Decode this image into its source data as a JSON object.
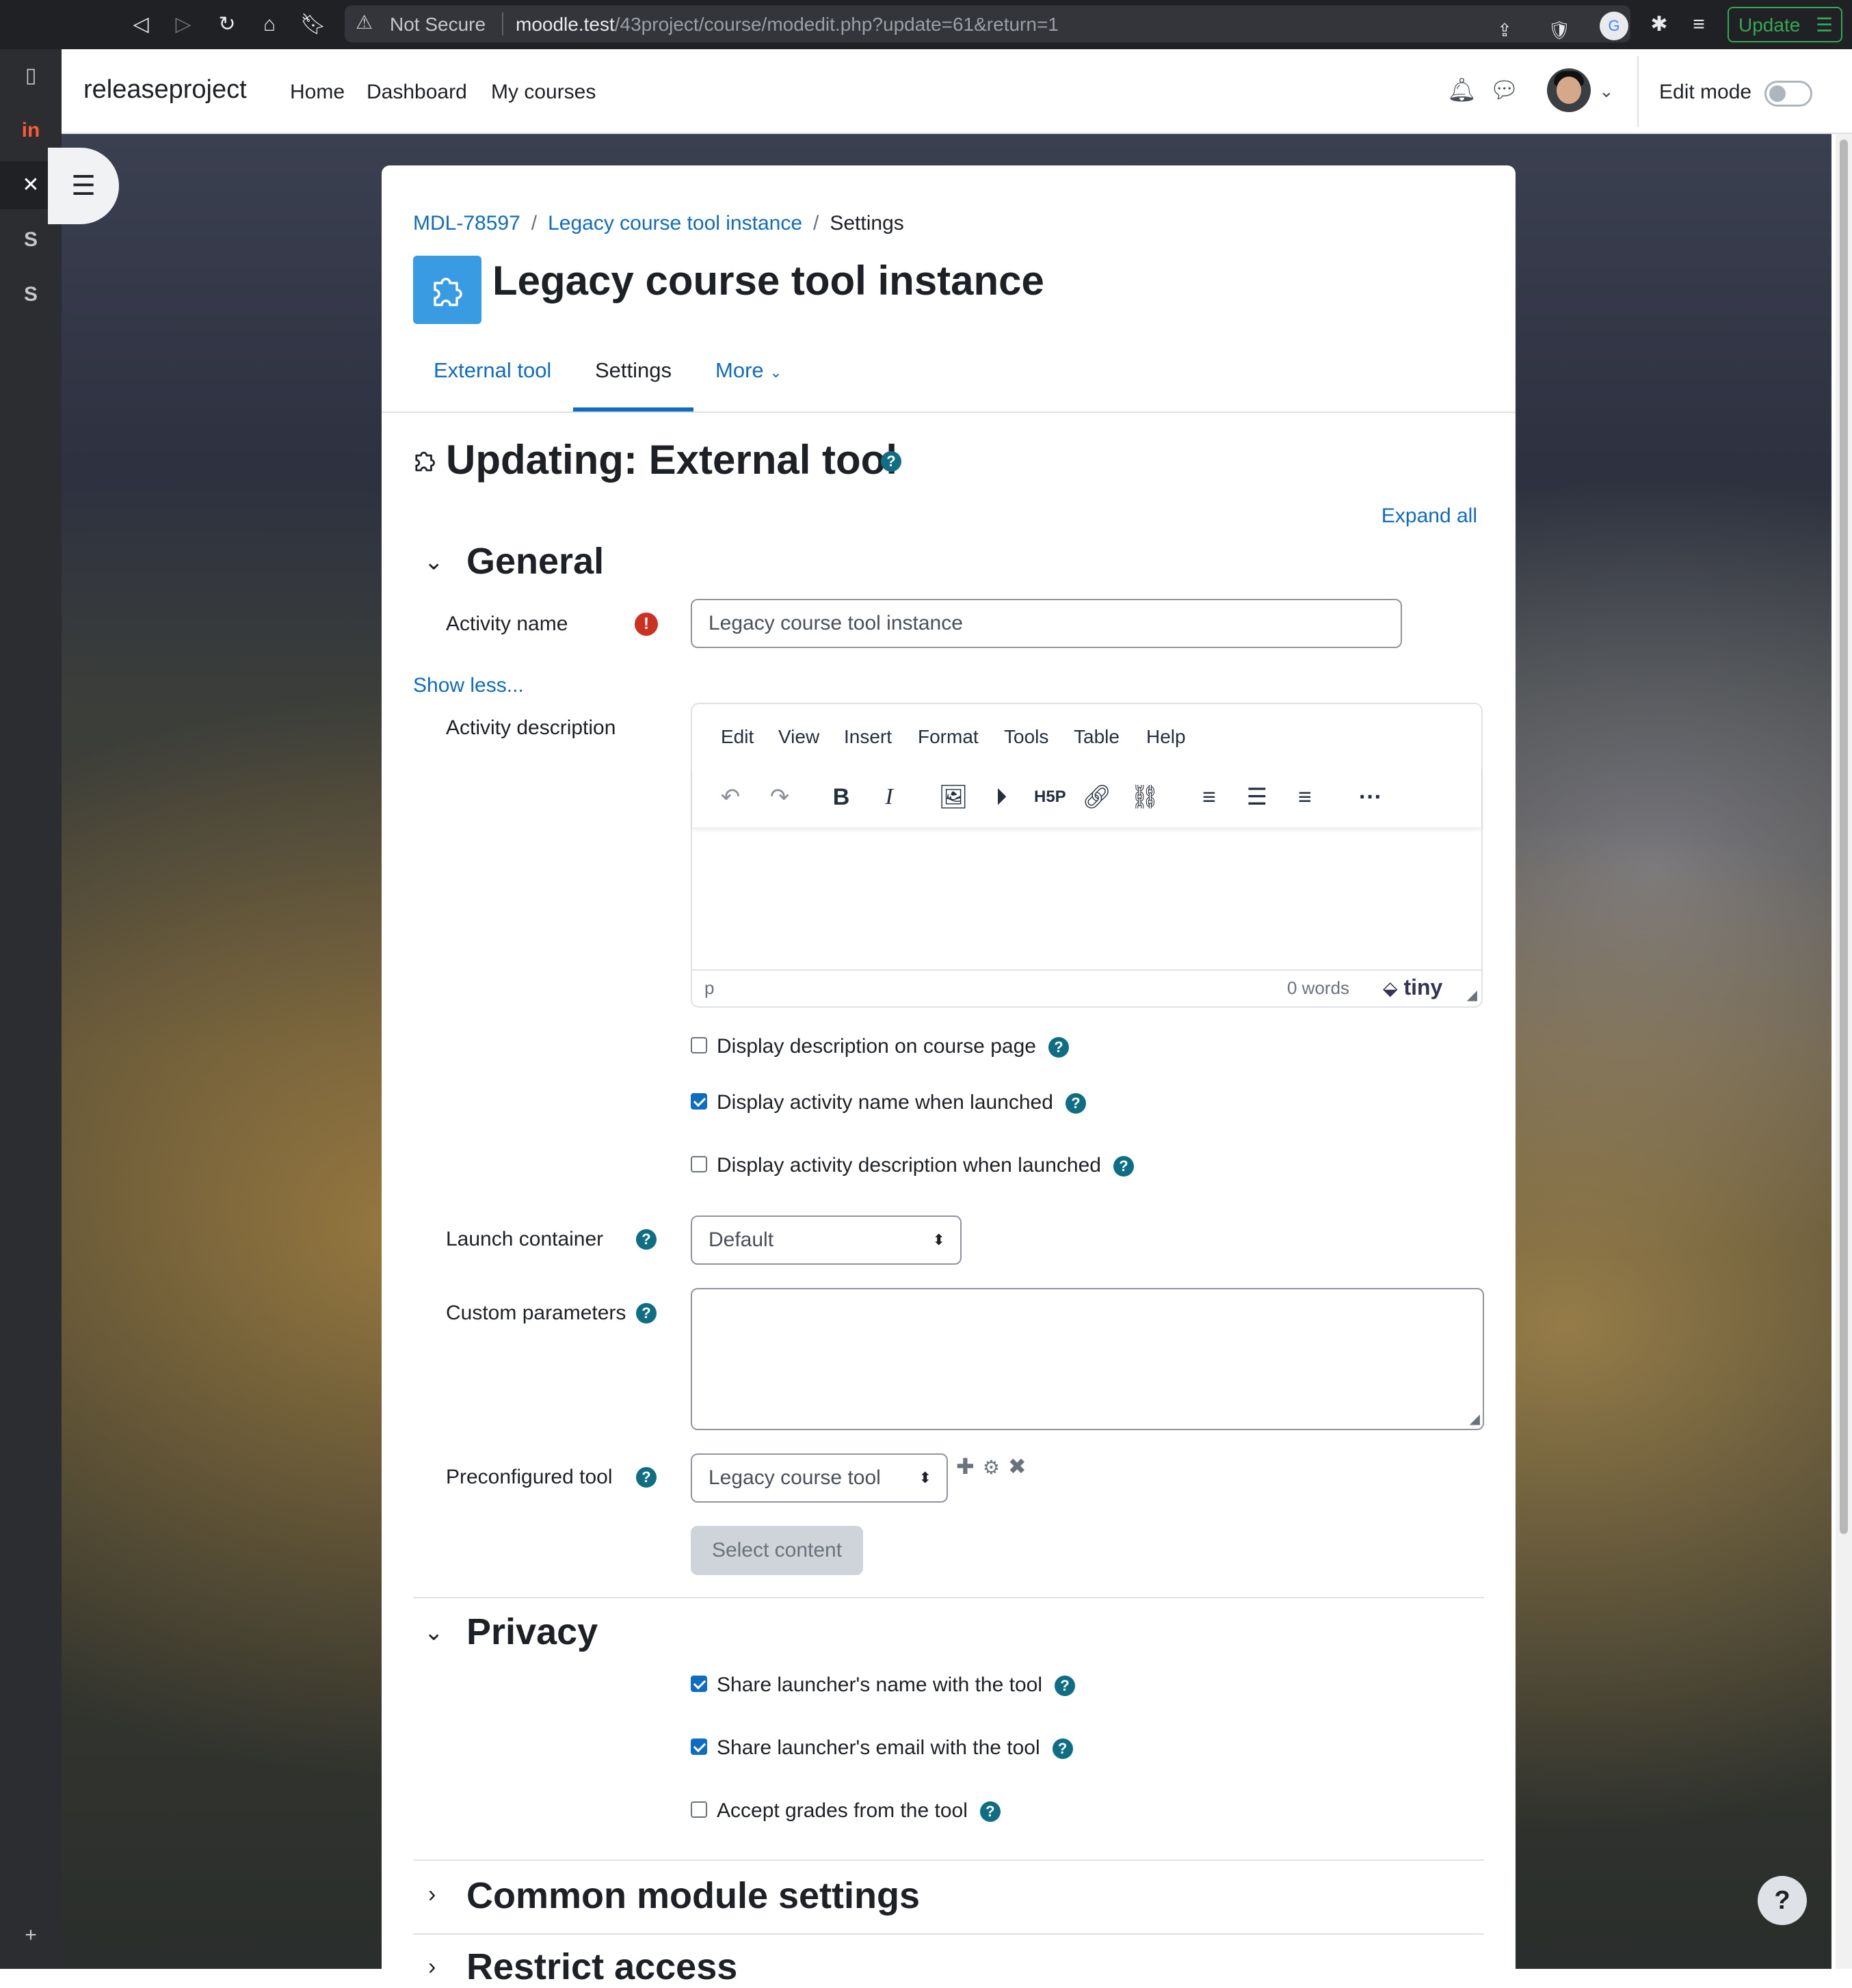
{
  "browser": {
    "not_secure": "Not Secure",
    "url_host": "moodle.test",
    "url_path": "/43project/course/modedit.php?update=61&return=1",
    "update_label": "Update"
  },
  "navbar": {
    "brand": "releaseproject",
    "links": [
      "Home",
      "Dashboard",
      "My courses"
    ],
    "edit_mode": "Edit mode"
  },
  "breadcrumb": [
    "MDL-78597",
    "Legacy course tool instance",
    "Settings"
  ],
  "header": {
    "title": "Legacy course tool instance"
  },
  "tabs": [
    "External tool",
    "Settings",
    "More"
  ],
  "form": {
    "title": "Updating: External tool",
    "expand_all": "Expand all",
    "general": {
      "title": "General",
      "activity_name_label": "Activity name",
      "activity_name_value": "Legacy course tool instance",
      "show_less": "Show less...",
      "activity_description_label": "Activity description",
      "editor": {
        "menus": [
          "Edit",
          "View",
          "Insert",
          "Format",
          "Tools",
          "Table",
          "Help"
        ],
        "status_path": "p",
        "word_count": "0 words",
        "brand": "tiny"
      },
      "display_description": "Display description on course page",
      "display_name_launched": "Display activity name when launched",
      "display_desc_launched": "Display activity description when launched",
      "launch_container_label": "Launch container",
      "launch_container_value": "Default",
      "custom_parameters_label": "Custom parameters",
      "preconfigured_tool_label": "Preconfigured tool",
      "preconfigured_tool_value": "Legacy course tool",
      "select_content": "Select content"
    },
    "privacy": {
      "title": "Privacy",
      "share_name": "Share launcher's name with the tool",
      "share_email": "Share launcher's email with the tool",
      "accept_grades": "Accept grades from the tool"
    },
    "common_module": {
      "title": "Common module settings"
    },
    "restrict_access": {
      "title": "Restrict access"
    }
  },
  "checkbox_states": {
    "display_description": false,
    "display_name_launched": true,
    "display_desc_launched": false,
    "share_name": true,
    "share_email": true,
    "accept_grades": false
  },
  "colors": {
    "link": "#0f6cbf",
    "help_icon": "#0f6e84",
    "required": "#ca3120",
    "module_icon": "#399be2"
  }
}
